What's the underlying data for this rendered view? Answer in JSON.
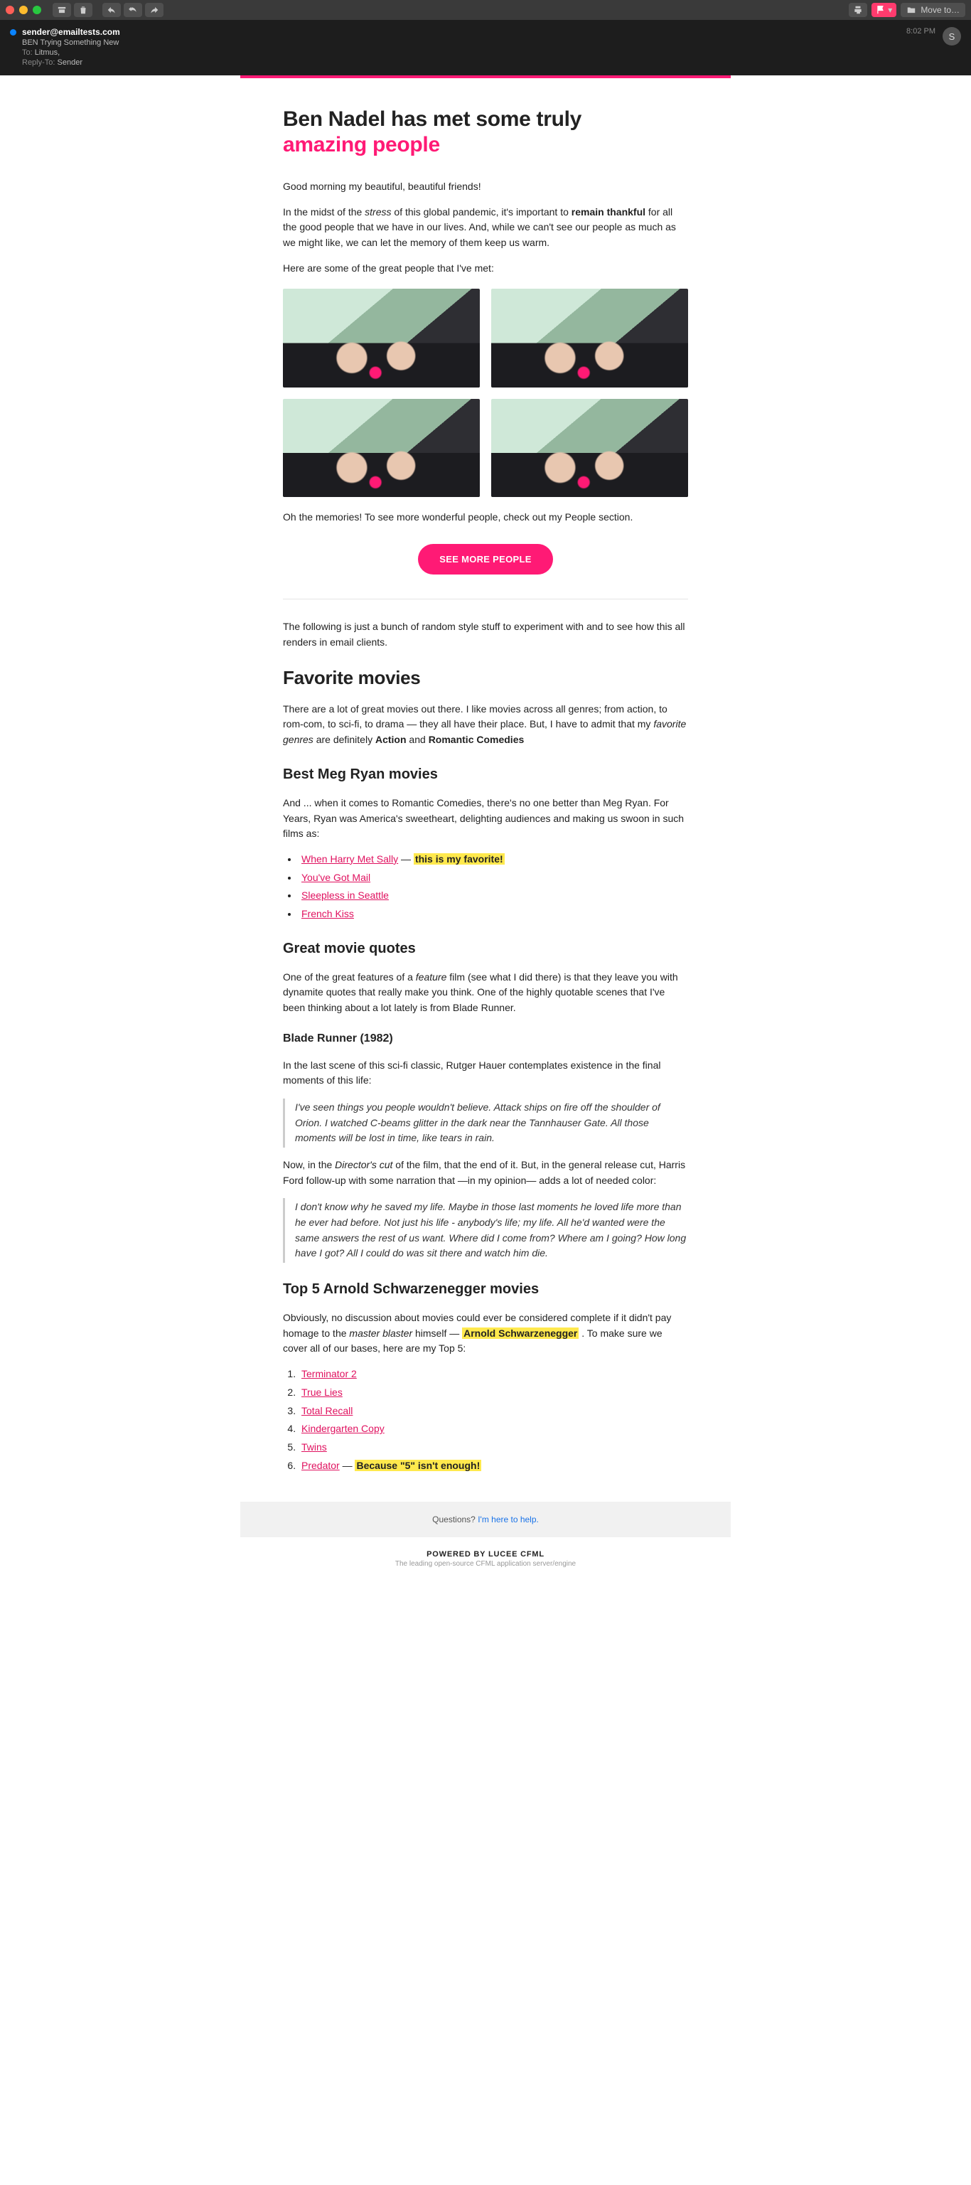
{
  "toolbar": {
    "move_label": "Move to…"
  },
  "header": {
    "sender": "sender@emailtests.com",
    "subject": "BEN Trying Something New",
    "to_label": "To:",
    "to_value": "Litmus,",
    "reply_to_label": "Reply-To:",
    "reply_to_value": "Sender",
    "time": "8:02 PM",
    "avatar_initial": "S"
  },
  "hero": {
    "line1": "Ben Nadel has met some truly",
    "line2": "amazing people"
  },
  "intro": {
    "greeting": "Good morning my beautiful, beautiful friends!",
    "p2_a": "In the midst of the ",
    "p2_stress": "stress",
    "p2_b": " of this global pandemic, it's important to ",
    "p2_thankful": "remain thankful",
    "p2_c": " for all the good people that we have in our lives. And, while we can't see our people as much as we might like, we can let the memory of them keep us warm.",
    "p3": "Here are some of the great people that I've met:"
  },
  "after_photos": "Oh the memories! To see more wonderful people, check out my People section.",
  "cta_label": "SEE MORE PEOPLE",
  "filler": "The following is just a bunch of random style stuff to experiment with and to see how this all renders in email clients.",
  "movies": {
    "heading": "Favorite movies",
    "intro_a": "There are a lot of great movies out there. I like movies across all genres; from action, to rom-com, to sci-fi, to drama — they all have their place. But, I have to admit that my ",
    "intro_fav": "favorite genres",
    "intro_b": " are definitely ",
    "intro_action": "Action",
    "intro_and": " and ",
    "intro_rom": "Romantic Comedies"
  },
  "meg": {
    "heading": "Best Meg Ryan movies",
    "intro": "And ... when it comes to Romantic Comedies, there's no one better than Meg Ryan. For Years, Ryan was America's sweetheart, delighting audiences and making us swoon in such films as:",
    "items": [
      {
        "text": "When Harry Met Sally",
        "suffix": " — ",
        "highlight": "this is my favorite!"
      },
      {
        "text": "You've Got Mail"
      },
      {
        "text": "Sleepless in Seattle"
      },
      {
        "text": "French Kiss"
      }
    ]
  },
  "quotes": {
    "heading": "Great movie quotes",
    "intro_a": "One of the great features of a ",
    "intro_feature": "feature",
    "intro_b": " film (see what I did there) is that they leave you with dynamite quotes that really make you think. One of the highly quotable scenes that I've been thinking about a lot lately is from Blade Runner."
  },
  "blade": {
    "heading": "Blade Runner (1982)",
    "intro": "In the last scene of this sci-fi classic, Rutger Hauer contemplates existence in the final moments of this life:",
    "q1": "I've seen things you people wouldn't believe. Attack ships on fire off the shoulder of Orion. I watched C-beams glitter in the dark near the Tannhauser Gate. All those moments will be lost in time, like tears in rain.",
    "mid_a": "Now, in the ",
    "mid_dc": "Director's cut",
    "mid_b": " of the film, that the end of it. But, in the general release cut, Harris Ford follow-up with some narration that —in my opinion— adds a lot of needed color:",
    "q2": "I don't know why he saved my life. Maybe in those last moments he loved life more than he ever had before. Not just his life - anybody's life; my life. All he'd wanted were the same answers the rest of us want. Where did I come from? Where am I going? How long have I got? All I could do was sit there and watch him die."
  },
  "arnold": {
    "heading": "Top 5 Arnold Schwarzenegger movies",
    "intro_a": "Obviously, no discussion about movies could ever be considered complete if it didn't pay homage to the ",
    "intro_mb": "master blaster",
    "intro_b": " himself — ",
    "intro_name": "Arnold Schwarzenegger",
    "intro_c": " . To make sure we cover all of our bases, here are my Top 5:",
    "items": [
      {
        "text": "Terminator 2"
      },
      {
        "text": "True Lies"
      },
      {
        "text": "Total Recall"
      },
      {
        "text": "Kindergarten Copy"
      },
      {
        "text": "Twins"
      },
      {
        "text": "Predator",
        "suffix": " — ",
        "highlight": "Because \"5\" isn't enough!"
      }
    ]
  },
  "footer": {
    "q": "Questions? ",
    "link": "I'm here to help."
  },
  "powered": {
    "line1": "POWERED BY LUCEE CFML",
    "line2": "The leading open-source CFML application server/engine"
  }
}
